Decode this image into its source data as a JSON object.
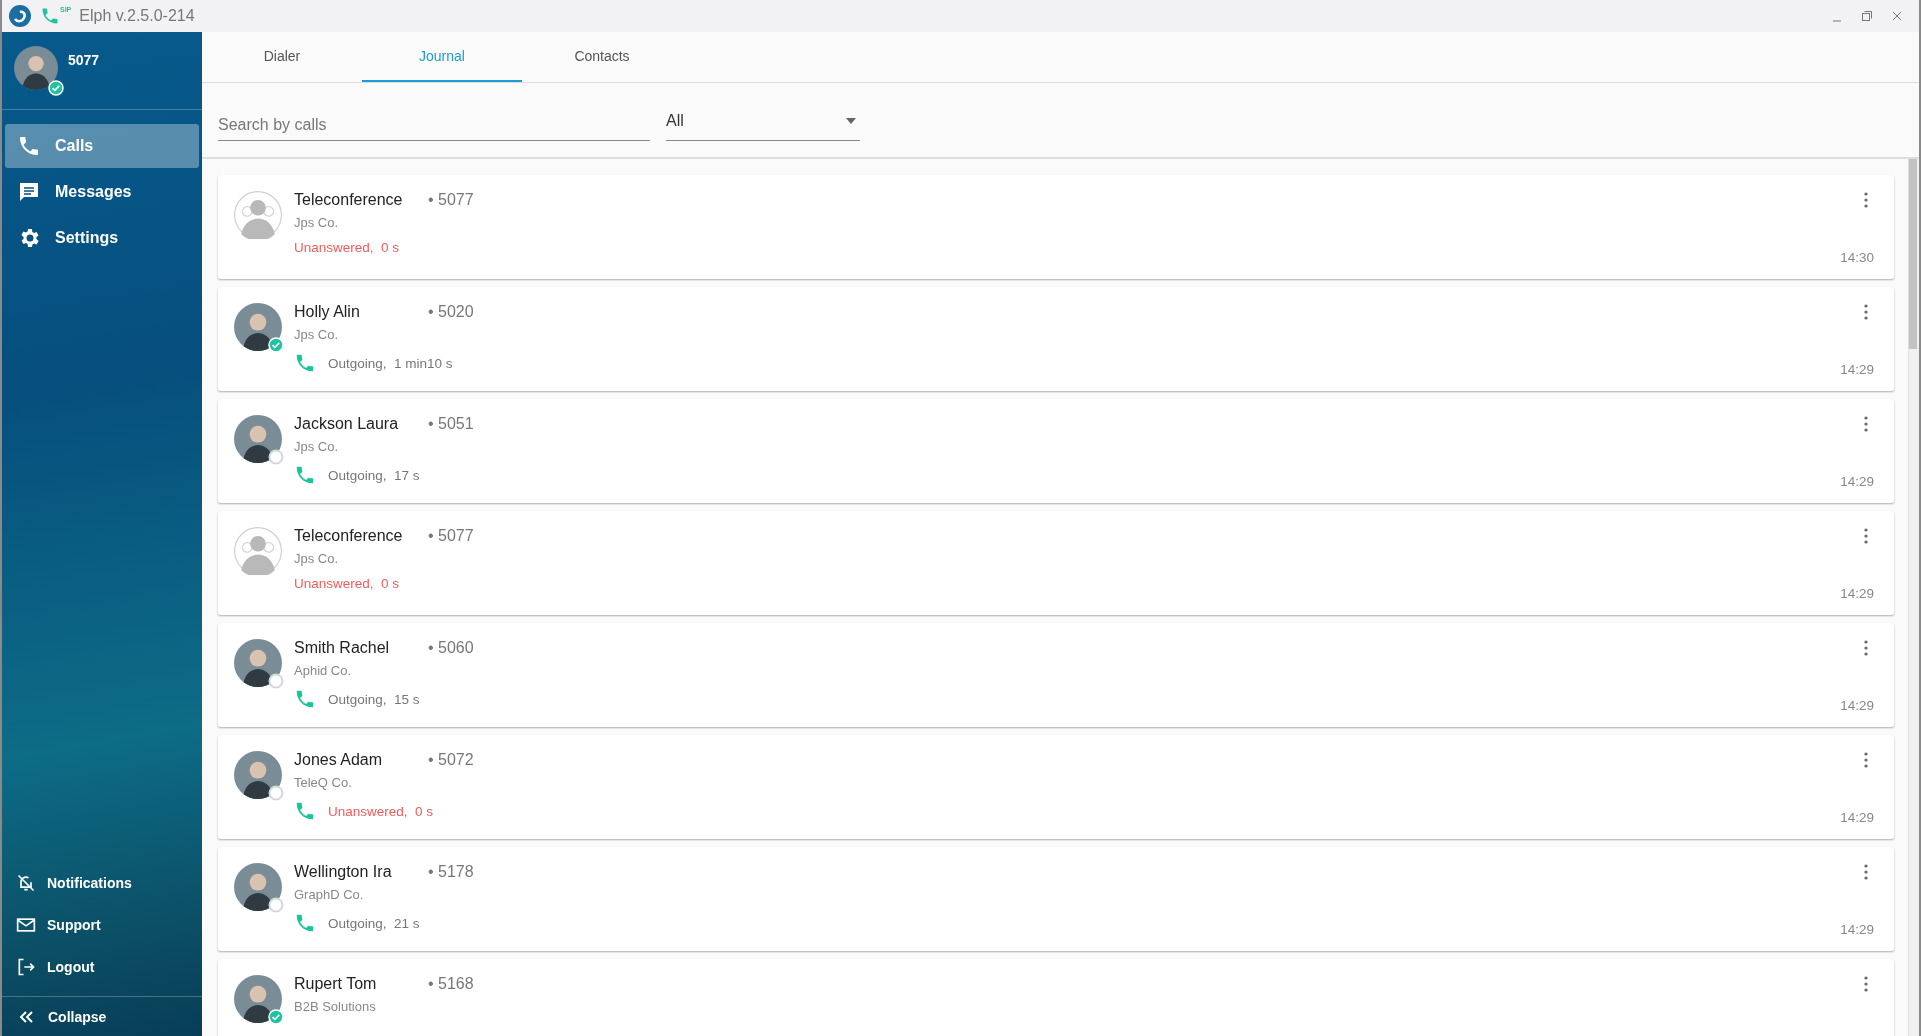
{
  "window": {
    "title": "Elph v.2.5.0-214",
    "icon_badge": "SIP"
  },
  "user": {
    "number": "5077",
    "online": true
  },
  "sidebar": {
    "items": [
      {
        "label": "Calls",
        "selected": true
      },
      {
        "label": "Messages",
        "selected": false
      },
      {
        "label": "Settings",
        "selected": false
      }
    ],
    "bottom_items": [
      {
        "label": "Notifications"
      },
      {
        "label": "Support"
      },
      {
        "label": "Logout"
      }
    ],
    "collapse": "Collapse"
  },
  "tabs": [
    {
      "label": "Dialer",
      "selected": false
    },
    {
      "label": "Journal",
      "selected": true
    },
    {
      "label": "Contacts",
      "selected": false
    }
  ],
  "search": {
    "placeholder": "Search by calls"
  },
  "filter": {
    "value": "All"
  },
  "calls": [
    {
      "kind": "conference",
      "name": "Teleconference",
      "number": "• 5077",
      "company": "Jps Co.",
      "phone_icon": false,
      "result": "Unanswered,  0 s",
      "missed": true,
      "time": "14:30"
    },
    {
      "kind": "contact",
      "name": "Holly Alin",
      "number": "• 5020",
      "company": "Jps Co.",
      "online": true,
      "phone_icon": true,
      "result": "Outgoing,  1 min10 s",
      "missed": false,
      "time": "14:29"
    },
    {
      "kind": "contact",
      "name": "Jackson Laura",
      "number": "• 5051",
      "company": "Jps Co.",
      "online": false,
      "phone_icon": true,
      "result": "Outgoing,  17 s",
      "missed": false,
      "time": "14:29"
    },
    {
      "kind": "conference",
      "name": "Teleconference",
      "number": "• 5077",
      "company": "Jps Co.",
      "phone_icon": false,
      "result": "Unanswered,  0 s",
      "missed": true,
      "time": "14:29"
    },
    {
      "kind": "contact",
      "name": "Smith Rachel",
      "number": "• 5060",
      "company": "Aphid Co.",
      "online": false,
      "phone_icon": true,
      "result": "Outgoing,  15 s",
      "missed": false,
      "time": "14:29"
    },
    {
      "kind": "contact",
      "name": "Jones Adam",
      "number": "• 5072",
      "company": "TeleQ Co.",
      "online": false,
      "phone_icon": true,
      "result": "Unanswered,  0 s",
      "missed": true,
      "time": "14:29"
    },
    {
      "kind": "contact",
      "name": "Wellington Ira",
      "number": "• 5178",
      "company": "GraphD Co.",
      "online": false,
      "phone_icon": true,
      "result": "Outgoing,  21 s",
      "missed": false,
      "time": "14:29"
    },
    {
      "kind": "contact",
      "name": "Rupert Tom",
      "number": "• 5168",
      "company": "B2B Solutions",
      "online": true
    }
  ]
}
